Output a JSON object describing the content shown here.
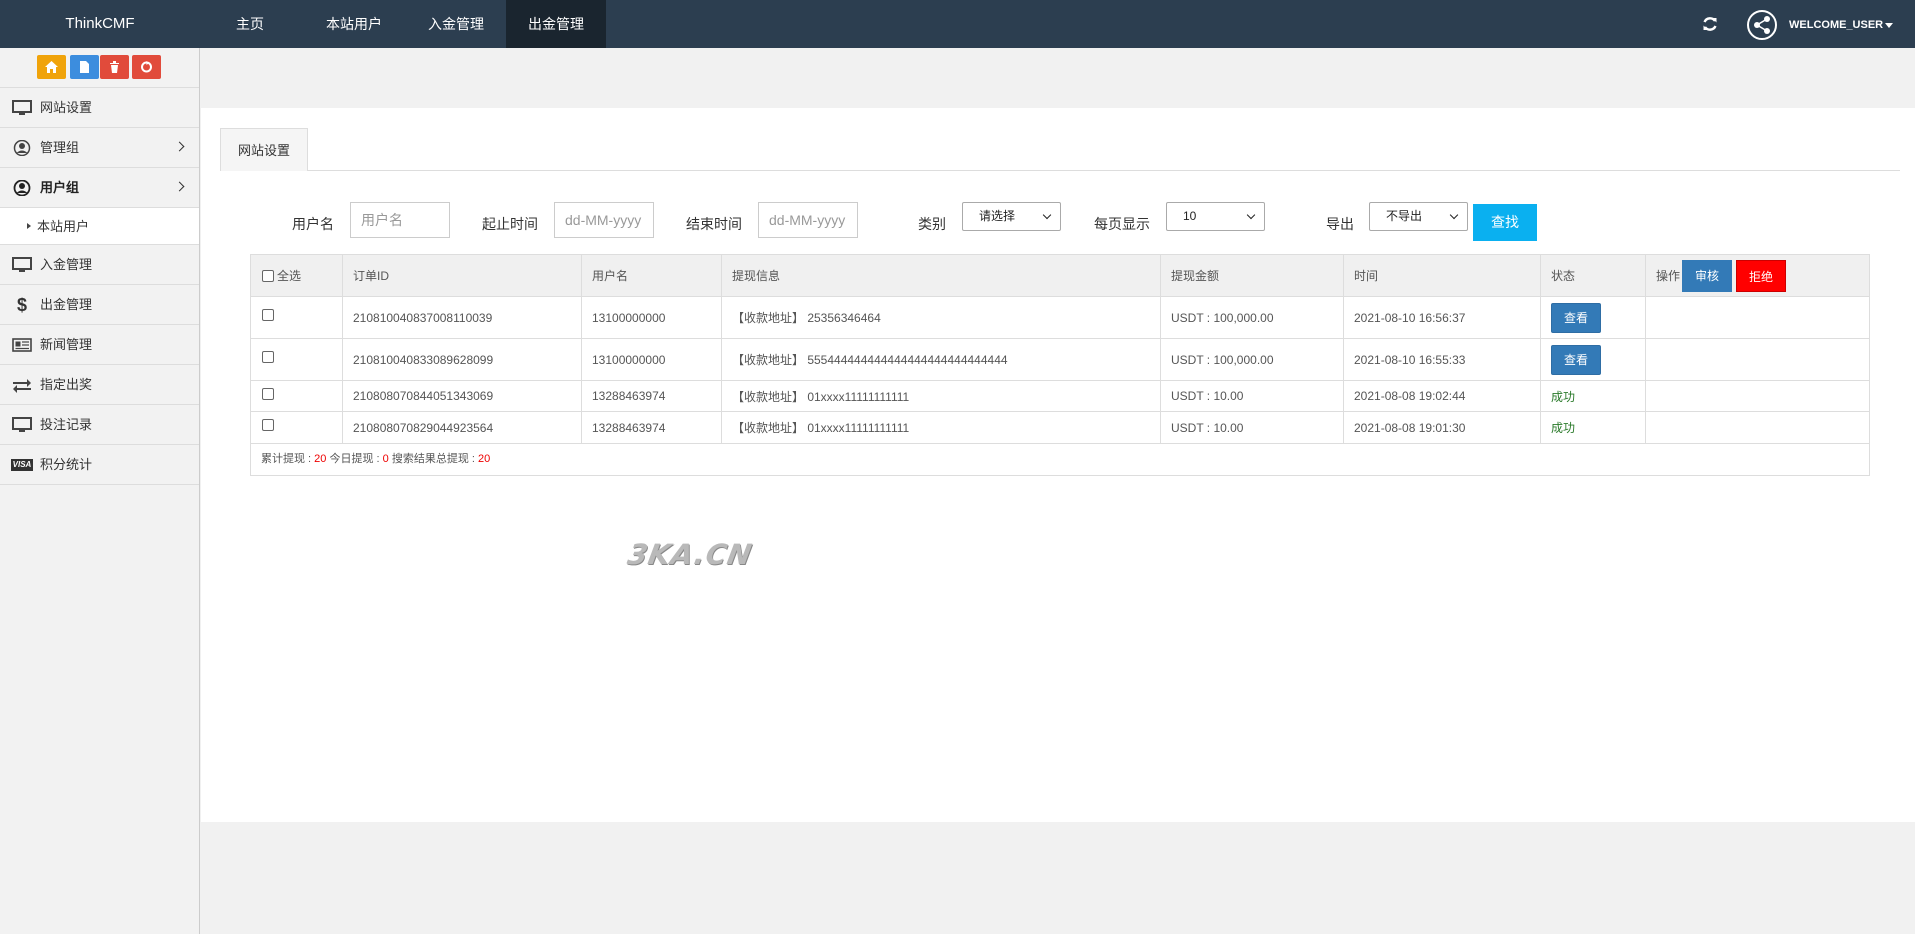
{
  "app": {
    "brand": "ThinkCMF",
    "user": "WELCOME_USER"
  },
  "nav": [
    {
      "label": "主页"
    },
    {
      "label": "本站用户"
    },
    {
      "label": "入金管理"
    },
    {
      "label": "出金管理"
    }
  ],
  "sidebar": {
    "shortcuts": [
      {
        "icon": "home-icon",
        "color": "#f0a30a"
      },
      {
        "icon": "file-icon",
        "color": "#3c8dde"
      },
      {
        "icon": "trash-icon",
        "color": "#e14b3b"
      },
      {
        "icon": "recycle-icon",
        "color": "#e14b3b"
      }
    ],
    "items": [
      {
        "label": "网站设置",
        "icon": "monitor-icon"
      },
      {
        "label": "管理组",
        "icon": "user-circle-icon"
      },
      {
        "label": "用户组",
        "icon": "user-icon"
      },
      {
        "label": "本站用户"
      },
      {
        "label": "入金管理",
        "icon": "monitor-icon"
      },
      {
        "label": "出金管理",
        "icon": "dollar-icon"
      },
      {
        "label": "新闻管理",
        "icon": "newspaper-icon"
      },
      {
        "label": "指定出奖",
        "icon": "exchange-icon"
      },
      {
        "label": "投注记录",
        "icon": "monitor-icon"
      },
      {
        "label": "积分统计",
        "icon": "visa-icon"
      }
    ]
  },
  "tab": {
    "label": "网站设置"
  },
  "filters": {
    "username_label": "用户名",
    "username_placeholder": "用户名",
    "start_label": "起止时间",
    "start_placeholder": "dd-MM-yyyy",
    "end_label": "结束时间",
    "end_placeholder": "dd-MM-yyyy",
    "type_label": "类别",
    "type_value": "请选择",
    "per_page_label": "每页显示",
    "per_page_value": "10",
    "export_label": "导出",
    "export_value": "不导出",
    "search_label": "查找"
  },
  "table": {
    "headers": {
      "select_all": "全选",
      "order_id": "订单ID",
      "username": "用户名",
      "withdraw_info": "提现信息",
      "amount": "提现金额",
      "time": "时间",
      "status": "状态",
      "action": "操作",
      "review": "审核",
      "reject": "拒绝"
    },
    "rows": [
      {
        "order_id": "210810040837008110039",
        "username": "13100000000",
        "info": "【收款地址】 25356346464",
        "amount": "USDT : 100,000.00",
        "time": "2021-08-10 16:56:37",
        "status": "查看"
      },
      {
        "order_id": "210810040833089628099",
        "username": "13100000000",
        "info": "【收款地址】 555444444444444444444444444444",
        "amount": "USDT : 100,000.00",
        "time": "2021-08-10 16:55:33",
        "status": "查看"
      },
      {
        "order_id": "210808070844051343069",
        "username": "13288463974",
        "info": "【收款地址】 01xxxx11111111111",
        "amount": "USDT : 10.00",
        "time": "2021-08-08 19:02:44",
        "status": "成功"
      },
      {
        "order_id": "210808070829044923564",
        "username": "13288463974",
        "info": "【收款地址】 01xxxx11111111111",
        "amount": "USDT : 10.00",
        "time": "2021-08-08 19:01:30",
        "status": "成功"
      }
    ],
    "summary": {
      "total_label": "累计提现 : ",
      "total_value": "20",
      "today_label": " 今日提现 : ",
      "today_value": "0",
      "search_total_label": " 搜索结果总提现 : ",
      "search_total_value": "20"
    }
  },
  "watermark": "3KA.CN"
}
